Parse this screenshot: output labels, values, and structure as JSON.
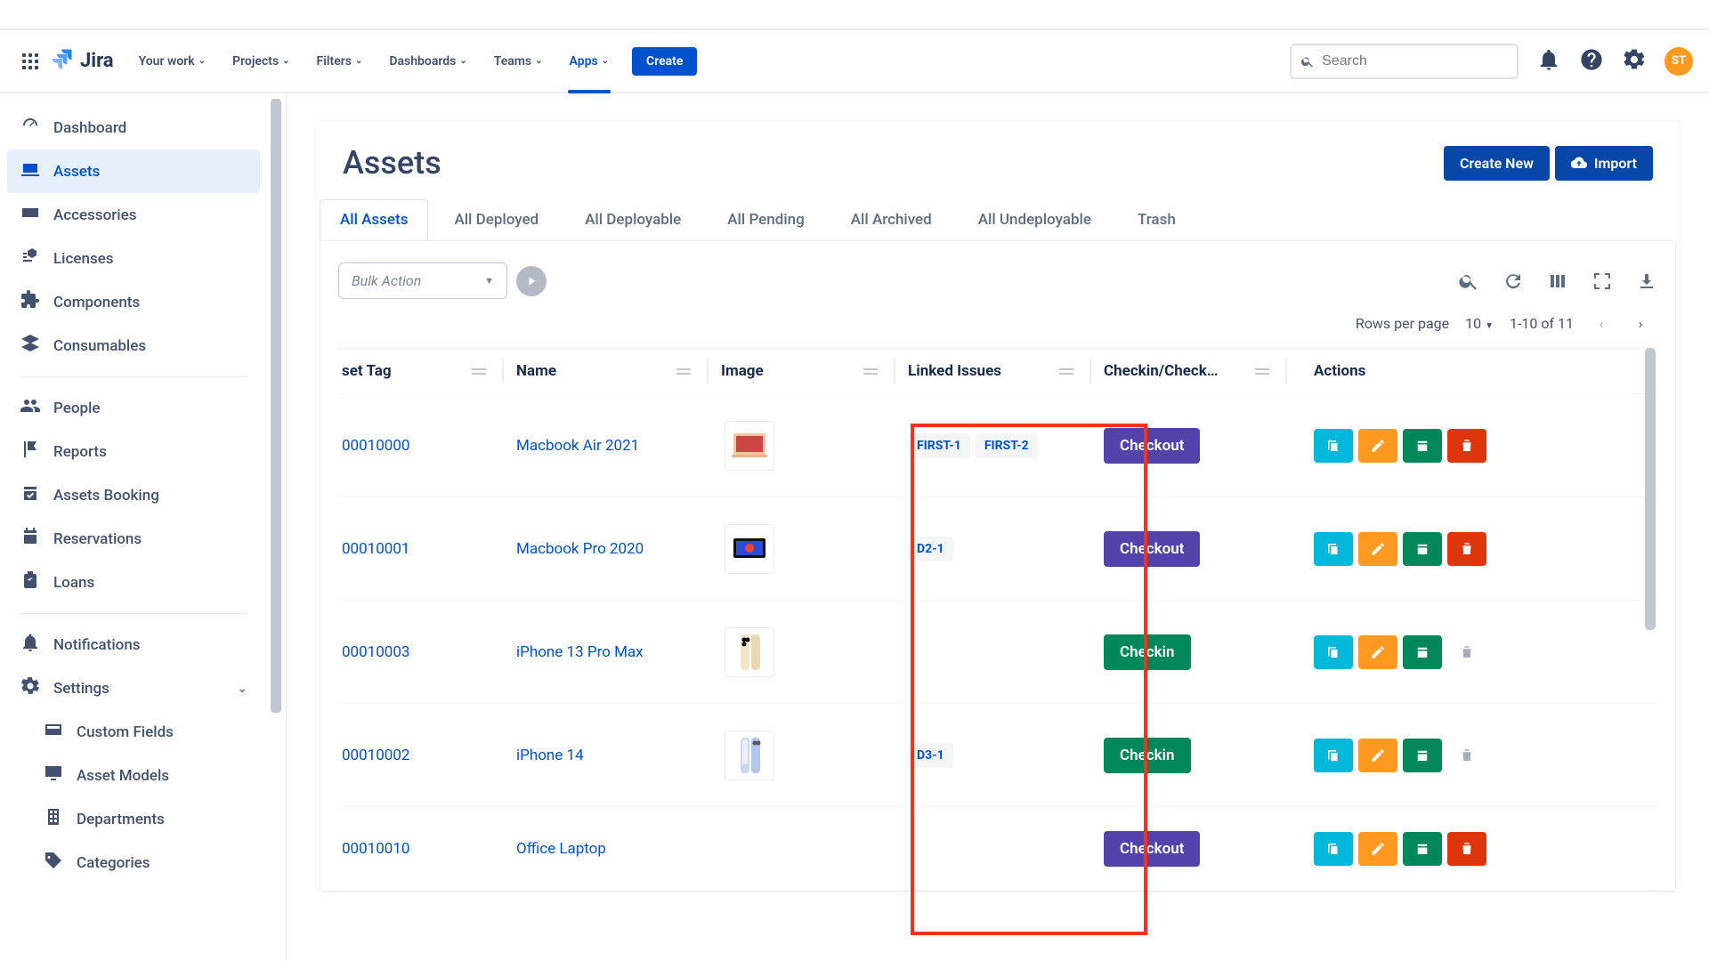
{
  "brand": {
    "name": "Jira",
    "avatar": "ST"
  },
  "topnav": {
    "items": [
      "Your work",
      "Projects",
      "Filters",
      "Dashboards",
      "Teams",
      "Apps"
    ],
    "active": 5,
    "create": "Create",
    "search_placeholder": "Search"
  },
  "sidebar": {
    "main": [
      {
        "label": "Dashboard",
        "icon": "gauge"
      },
      {
        "label": "Assets",
        "icon": "laptop",
        "selected": true
      },
      {
        "label": "Accessories",
        "icon": "keyboard"
      },
      {
        "label": "Licenses",
        "icon": "license"
      },
      {
        "label": "Components",
        "icon": "puzzle"
      },
      {
        "label": "Consumables",
        "icon": "layers"
      }
    ],
    "mid": [
      {
        "label": "People",
        "icon": "people"
      },
      {
        "label": "Reports",
        "icon": "flag"
      },
      {
        "label": "Assets Booking",
        "icon": "calendar-check"
      },
      {
        "label": "Reservations",
        "icon": "calendar"
      },
      {
        "label": "Loans",
        "icon": "clipboard"
      }
    ],
    "bottom": [
      {
        "label": "Notifications",
        "icon": "bell"
      },
      {
        "label": "Settings",
        "icon": "gear",
        "expanded": true
      }
    ],
    "sub": [
      {
        "label": "Custom Fields",
        "icon": "card"
      },
      {
        "label": "Asset Models",
        "icon": "monitor"
      },
      {
        "label": "Departments",
        "icon": "building"
      },
      {
        "label": "Categories",
        "icon": "tag"
      }
    ]
  },
  "page": {
    "title": "Assets",
    "btn_new": "Create New",
    "btn_import": "Import"
  },
  "tabs": [
    "All Assets",
    "All Deployed",
    "All Deployable",
    "All Pending",
    "All Archived",
    "All Undeployable",
    "Trash"
  ],
  "bulk_placeholder": "Bulk Action",
  "pager": {
    "rpp_label": "Rows per page",
    "rpp": "10",
    "range": "1-10 of 11"
  },
  "columns": [
    "set Tag",
    "Name",
    "Image",
    "Linked Issues",
    "Checkin/Check…",
    "Actions"
  ],
  "rows": [
    {
      "tag": "00010000",
      "name": "Macbook Air 2021",
      "img": "macbook-air",
      "issues": [
        "FIRST-1",
        "FIRST-2"
      ],
      "status": "Checkout",
      "status_type": "purple",
      "del": true
    },
    {
      "tag": "00010001",
      "name": "Macbook Pro 2020",
      "img": "macbook-pro",
      "issues": [
        "D2-1"
      ],
      "status": "Checkout",
      "status_type": "purple",
      "del": true
    },
    {
      "tag": "00010003",
      "name": "iPhone 13 Pro Max",
      "img": "iphone-gold",
      "issues": [],
      "status": "Checkin",
      "status_type": "green",
      "del": false
    },
    {
      "tag": "00010002",
      "name": "iPhone 14",
      "img": "iphone-blue",
      "issues": [
        "D3-1"
      ],
      "status": "Checkin",
      "status_type": "green",
      "del": false
    },
    {
      "tag": "00010010",
      "name": "Office Laptop",
      "img": "",
      "issues": [],
      "status": "Checkout",
      "status_type": "purple",
      "del": true
    }
  ]
}
